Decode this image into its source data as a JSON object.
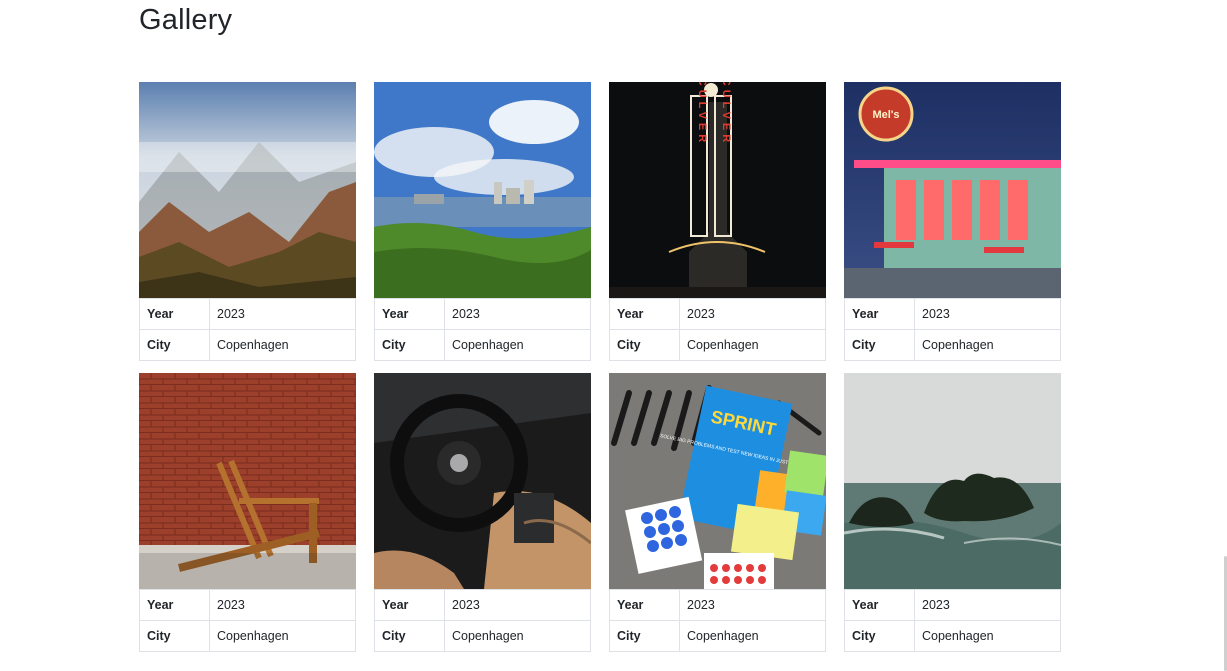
{
  "page": {
    "title": "Gallery"
  },
  "items": [
    {
      "year_label": "Year",
      "year": "2023",
      "city_label": "City",
      "city": "Copenhagen",
      "image_icon": "misty-mountain-valley-photo"
    },
    {
      "year_label": "Year",
      "year": "2023",
      "city_label": "City",
      "city": "Copenhagen",
      "image_icon": "waterfront-city-skyline-photo"
    },
    {
      "year_label": "Year",
      "year": "2023",
      "city_label": "City",
      "city": "Copenhagen",
      "image_icon": "culver-neon-sign-photo"
    },
    {
      "year_label": "Year",
      "year": "2023",
      "city_label": "City",
      "city": "Copenhagen",
      "image_icon": "retro-diner-night-photo"
    },
    {
      "year_label": "Year",
      "year": "2023",
      "city_label": "City",
      "city": "Copenhagen",
      "image_icon": "wooden-chair-brick-wall-photo"
    },
    {
      "year_label": "Year",
      "year": "2023",
      "city_label": "City",
      "city": "Copenhagen",
      "image_icon": "car-interior-steering-wheel-photo"
    },
    {
      "year_label": "Year",
      "year": "2023",
      "city_label": "City",
      "city": "Copenhagen",
      "image_icon": "sprint-book-sticky-notes-photo"
    },
    {
      "year_label": "Year",
      "year": "2023",
      "city_label": "City",
      "city": "Copenhagen",
      "image_icon": "rocky-island-sea-photo"
    }
  ],
  "photos": {
    "neon_sign_letters": "CULVER",
    "diner_sign_text": "Mel's",
    "book_title": "SPRINT",
    "book_subtitle": "SOLVE BIG PROBLEMS AND TEST NEW IDEAS IN JUST FIVE DAYS"
  }
}
